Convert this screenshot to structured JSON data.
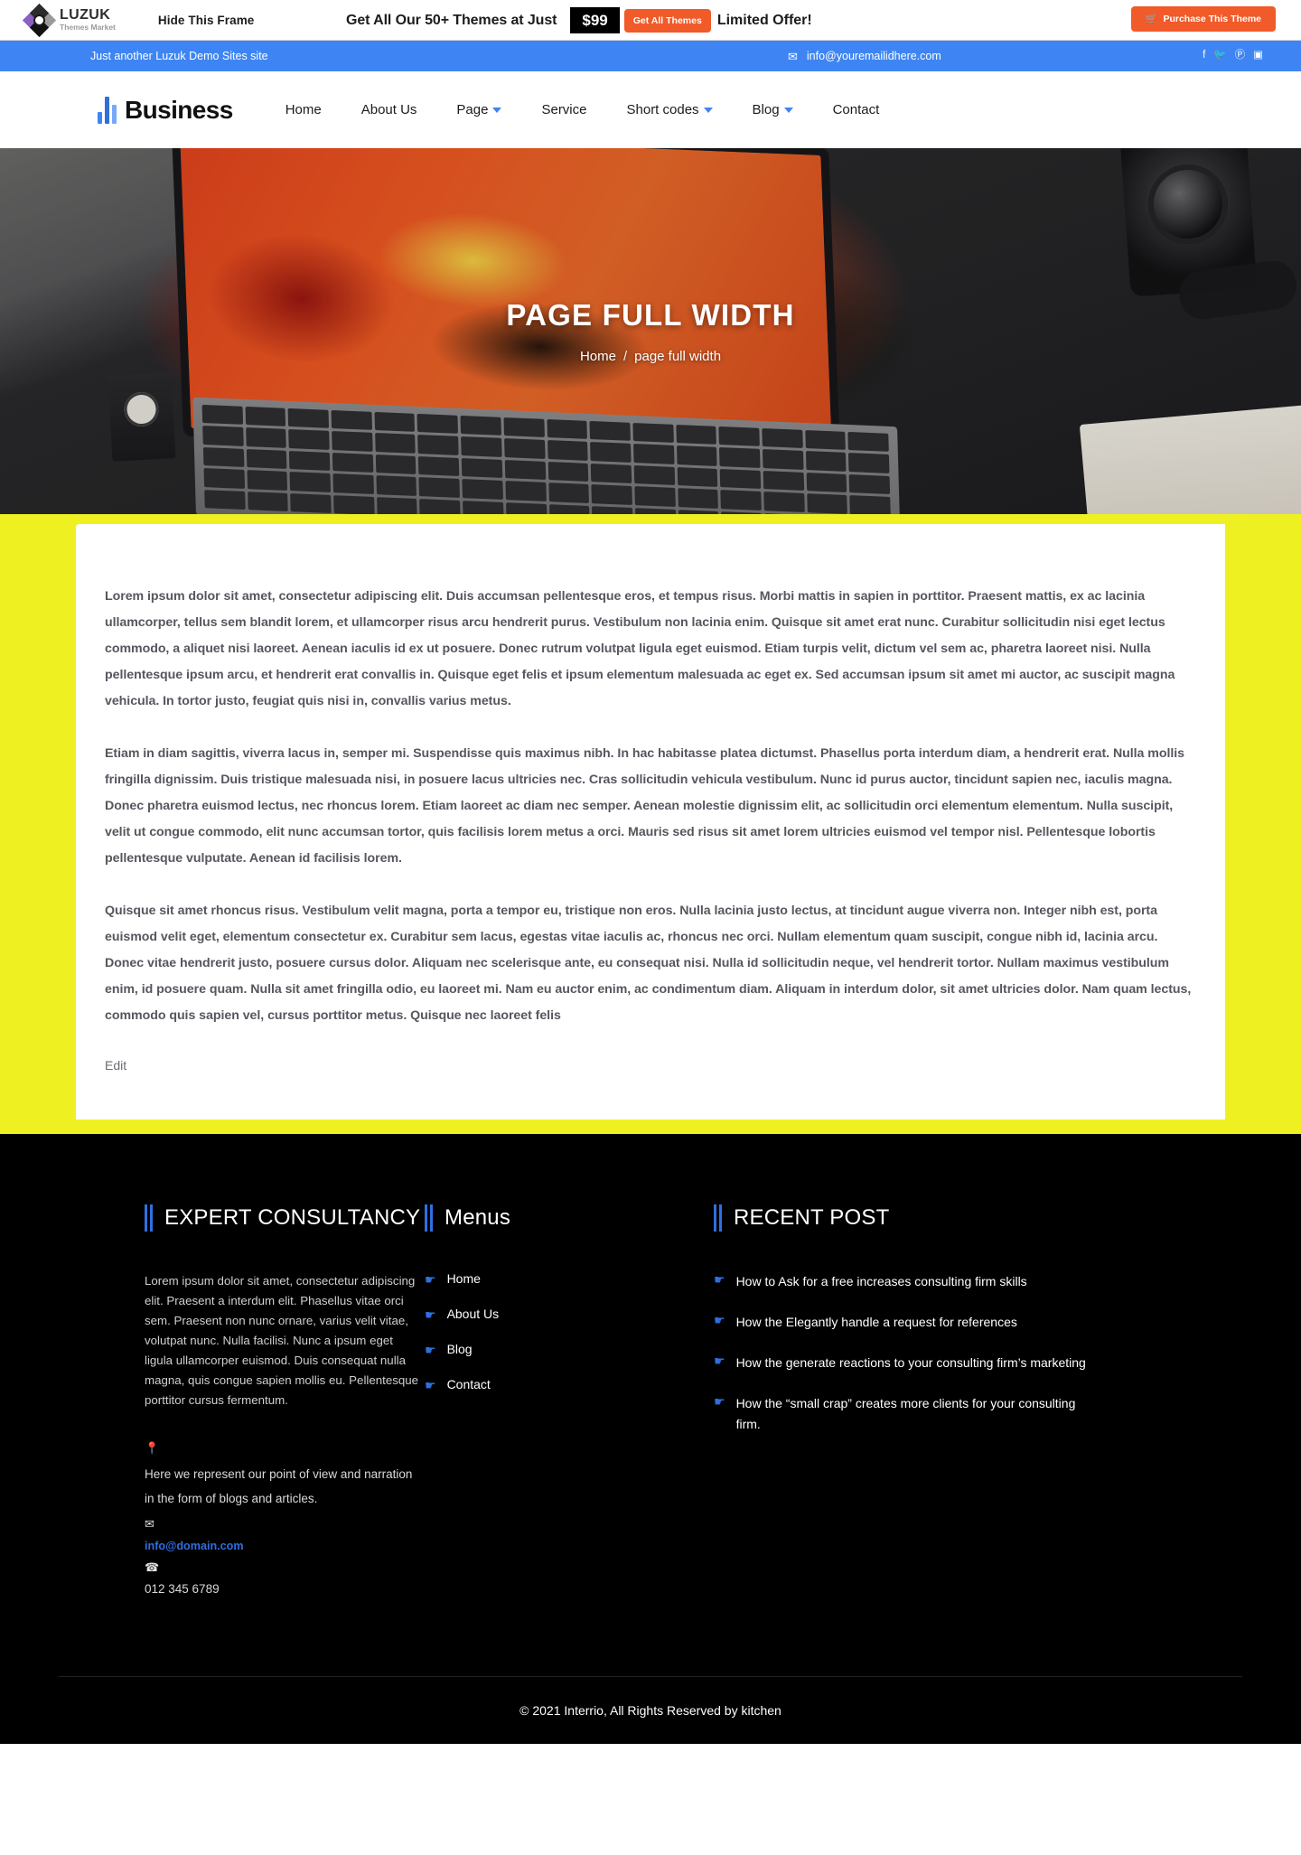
{
  "promo": {
    "brand_line1": "LUZUK",
    "brand_line2": "Themes Market",
    "hide_frame": "Hide This Frame",
    "offer_text": "Get All Our 50+ Themes at Just",
    "price": "$99",
    "get_all_themes": "Get All Themes",
    "limited": "Limited Offer!",
    "purchase": "Purchase This Theme",
    "cart_icon": "🛒",
    "accent_color": "#f15a29"
  },
  "info_bar": {
    "tagline": "Just another Luzuk Demo Sites site",
    "email": "info@youremailidhere.com",
    "envelope_icon": "✉",
    "socials": [
      {
        "name": "facebook-icon",
        "glyph": "f"
      },
      {
        "name": "twitter-icon",
        "glyph": "🐦"
      },
      {
        "name": "pinterest-icon",
        "glyph": "Ⓟ"
      },
      {
        "name": "instagram-icon",
        "glyph": "▣"
      }
    ],
    "background_color": "#3e85f3"
  },
  "nav": {
    "brand": "Business",
    "items": [
      {
        "label": "Home",
        "has_dropdown": false
      },
      {
        "label": "About Us",
        "has_dropdown": false
      },
      {
        "label": "Page",
        "has_dropdown": true
      },
      {
        "label": "Service",
        "has_dropdown": false
      },
      {
        "label": "Short codes",
        "has_dropdown": true
      },
      {
        "label": "Blog",
        "has_dropdown": true
      },
      {
        "label": "Contact",
        "has_dropdown": false
      }
    ]
  },
  "hero": {
    "title": "PAGE FULL WIDTH",
    "breadcrumb_home": "Home",
    "breadcrumb_sep": "/",
    "breadcrumb_current": "page full width"
  },
  "content": {
    "background_color": "#eef021",
    "paragraphs": [
      "Lorem ipsum dolor sit amet, consectetur adipiscing elit. Duis accumsan pellentesque eros, et tempus risus. Morbi mattis in sapien in porttitor. Praesent mattis, ex ac lacinia ullamcorper, tellus sem blandit lorem, et ullamcorper risus arcu hendrerit purus. Vestibulum non lacinia enim. Quisque sit amet erat nunc. Curabitur sollicitudin nisi eget lectus commodo, a aliquet nisi laoreet. Aenean iaculis id ex ut posuere. Donec rutrum volutpat ligula eget euismod. Etiam turpis velit, dictum vel sem ac, pharetra laoreet nisi. Nulla pellentesque ipsum arcu, et hendrerit erat convallis in. Quisque eget felis et ipsum elementum malesuada ac eget ex. Sed accumsan ipsum sit amet mi auctor, ac suscipit magna vehicula. In tortor justo, feugiat quis nisi in, convallis varius metus.",
      "Etiam in diam sagittis, viverra lacus in, semper mi. Suspendisse quis maximus nibh. In hac habitasse platea dictumst. Phasellus porta interdum diam, a hendrerit erat. Nulla mollis fringilla dignissim. Duis tristique malesuada nisi, in posuere lacus ultricies nec. Cras sollicitudin vehicula vestibulum. Nunc id purus auctor, tincidunt sapien nec, iaculis magna. Donec pharetra euismod lectus, nec rhoncus lorem. Etiam laoreet ac diam nec semper. Aenean molestie dignissim elit, ac sollicitudin orci elementum elementum. Nulla suscipit, velit ut congue commodo, elit nunc accumsan tortor, quis facilisis lorem metus a orci. Mauris sed risus sit amet lorem ultricies euismod vel tempor nisl. Pellentesque lobortis pellentesque vulputate. Aenean id facilisis lorem.",
      "Quisque sit amet rhoncus risus. Vestibulum velit magna, porta a tempor eu, tristique non eros. Nulla lacinia justo lectus, at tincidunt augue viverra non. Integer nibh est, porta euismod velit eget, elementum consectetur ex. Curabitur sem lacus, egestas vitae iaculis ac, rhoncus nec orci. Nullam elementum quam suscipit, congue nibh id, lacinia arcu. Donec vitae hendrerit justo, posuere cursus dolor. Aliquam nec scelerisque ante, eu consequat nisi. Nulla id sollicitudin neque, vel hendrerit tortor. Nullam maximus vestibulum enim, id posuere quam. Nulla sit amet fringilla odio, eu laoreet mi. Nam eu auctor enim, ac condimentum diam. Aliquam in interdum dolor, sit amet ultricies dolor. Nam quam lectus, commodo quis sapien vel, cursus porttitor metus. Quisque nec laoreet felis"
    ],
    "edit_label": "Edit"
  },
  "footer": {
    "about": {
      "title": "EXPERT CONSULTANCY",
      "text": "Lorem ipsum dolor sit amet, consectetur adipiscing elit. Praesent a interdum elit. Phasellus vitae orci sem. Praesent non nunc ornare, varius velit vitae, volutpat nunc. Nulla facilisi. Nunc a ipsum eget ligula ullamcorper euismod. Duis consequat nulla magna, quis congue sapien mollis eu. Pellentesque porttitor cursus fermentum.",
      "location_icon": "📍",
      "address": "Here we represent our point of view and narration in the form of blogs and articles.",
      "mail_icon": "✉",
      "email": "info@domain.com",
      "phone_icon": "☎",
      "phone": "012 345 6789"
    },
    "menus": {
      "title": "Menus",
      "items": [
        "Home",
        "About Us",
        "Blog",
        "Contact"
      ]
    },
    "recent": {
      "title": "RECENT POST",
      "items": [
        "How to Ask for a free increases consulting firm skills",
        "How the Elegantly handle a request for references",
        "How the generate reactions to your consulting firm’s marketing",
        "How the “small crap” creates more clients for your consulting firm."
      ]
    },
    "hand_icon": "☛",
    "accent_color": "#2f6fe0"
  },
  "copyright": "© 2021 Interrio, All Rights Reserved by kitchen"
}
